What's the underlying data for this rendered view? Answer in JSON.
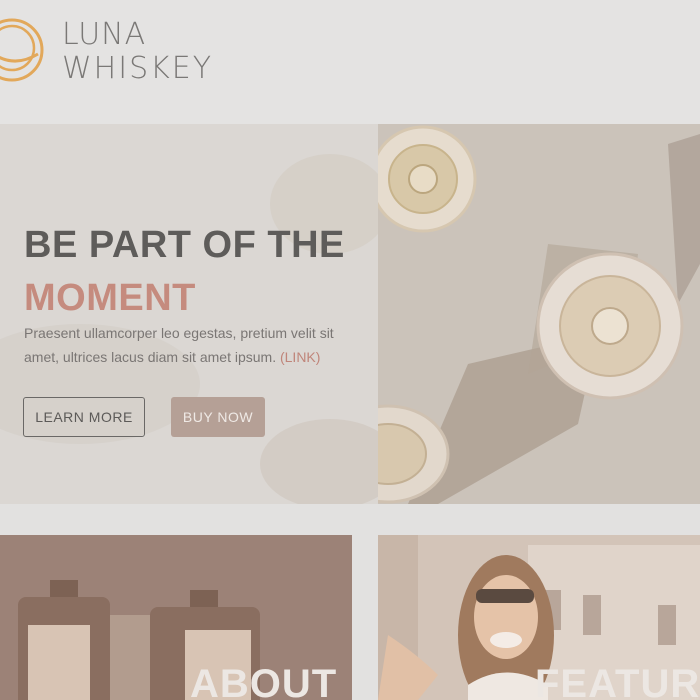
{
  "brand": {
    "line1": "LUNA",
    "line2": "WHISKEY",
    "accent": "#e2a85a"
  },
  "hero": {
    "title_line1": "BE PART OF THE",
    "title_line2": "MOMENT",
    "body": "Praesent ullamcorper leo egestas, pretium velit sit amet, ultrices lacus diam sit amet ipsum.",
    "link_text": "(LINK)",
    "learn_more_label": "LEARN MORE",
    "buy_now_label": "BUY NOW",
    "accent_color": "#c58b7e"
  },
  "cards": {
    "about_label": "ABOUT",
    "features_label": "FEATURES"
  }
}
